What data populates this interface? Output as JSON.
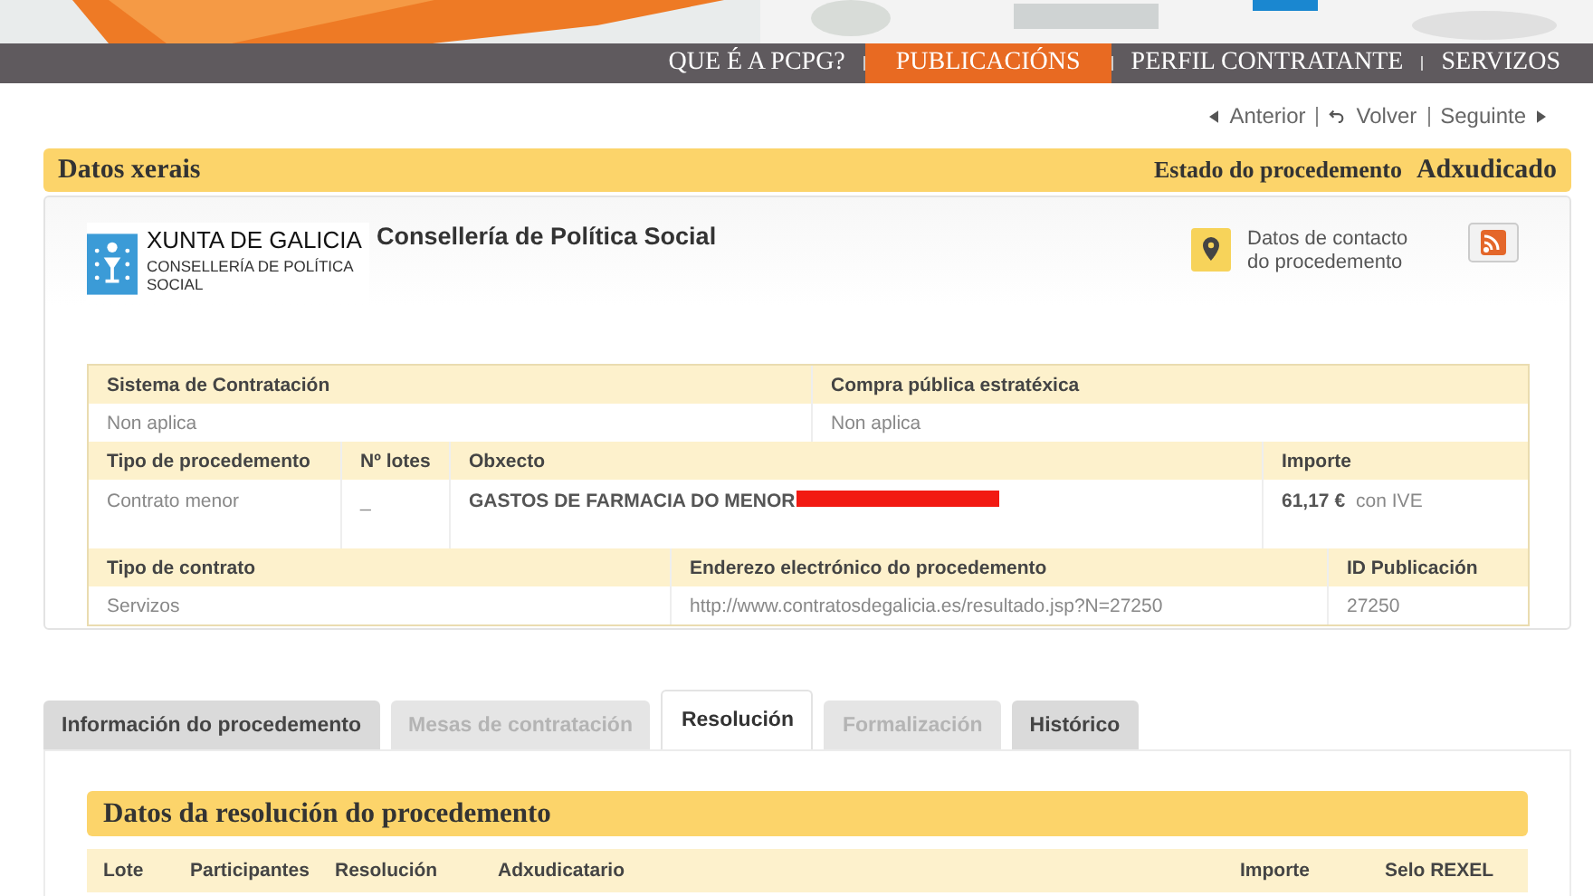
{
  "nav": [
    {
      "label": "QUE É A PCPG?",
      "selected": false
    },
    {
      "label": "PUBLICACIÓNS",
      "selected": true
    },
    {
      "label": "PERFIL CONTRATANTE",
      "selected": false
    },
    {
      "label": "SERVIZOS",
      "selected": false
    }
  ],
  "pager": {
    "previous": "Anterior",
    "back": "Volver",
    "next": "Seguinte"
  },
  "section": {
    "title": "Datos xerais",
    "status_label": "Estado do procedemento",
    "status": "Adxudicado"
  },
  "organization": {
    "logo_title": "XUNTA DE GALICIA",
    "logo_subtitle": "CONSELLERÍA DE POLÍTICA SOCIAL",
    "name": "Consellería de Política Social",
    "contact": "Datos de contacto do procedemento"
  },
  "details": [
    [
      {
        "label": "Sistema de Contratación",
        "value": "Non aplica"
      },
      {
        "label": "Compra pública estratéxica",
        "value": "Non aplica"
      }
    ],
    [
      {
        "label": "Tipo de procedemento",
        "value": "Contrato menor"
      },
      {
        "label": "Nº lotes",
        "value": "_"
      },
      {
        "label": "Obxecto",
        "value": "GASTOS DE FARMACIA DO MENOR",
        "redacted": true
      },
      {
        "label": "Importe",
        "value": "61,17 €",
        "note": "con IVE"
      }
    ],
    [
      {
        "label": "Tipo de contrato",
        "value": "Servizos"
      },
      {
        "label": "Enderezo electrónico do procedemento",
        "value": "http://www.contratosdegalicia.es/resultado.jsp?N=27250"
      },
      {
        "label": "ID Publicación",
        "value": "27250"
      }
    ]
  ],
  "tabs": [
    {
      "label": "Información do procedemento",
      "selected": false,
      "disabled": false
    },
    {
      "label": "Mesas de contratación",
      "selected": false,
      "disabled": true
    },
    {
      "label": "Resolución",
      "selected": true,
      "disabled": false
    },
    {
      "label": "Formalización",
      "selected": false,
      "disabled": true
    },
    {
      "label": "Histórico",
      "selected": false,
      "disabled": false
    }
  ],
  "resolution": {
    "title": "Datos da resolución do procedemento",
    "columns": [
      "Lote",
      "Participantes",
      "Resolución",
      "Adxudicatario",
      "Importe",
      "Selo REXEL"
    ]
  }
}
